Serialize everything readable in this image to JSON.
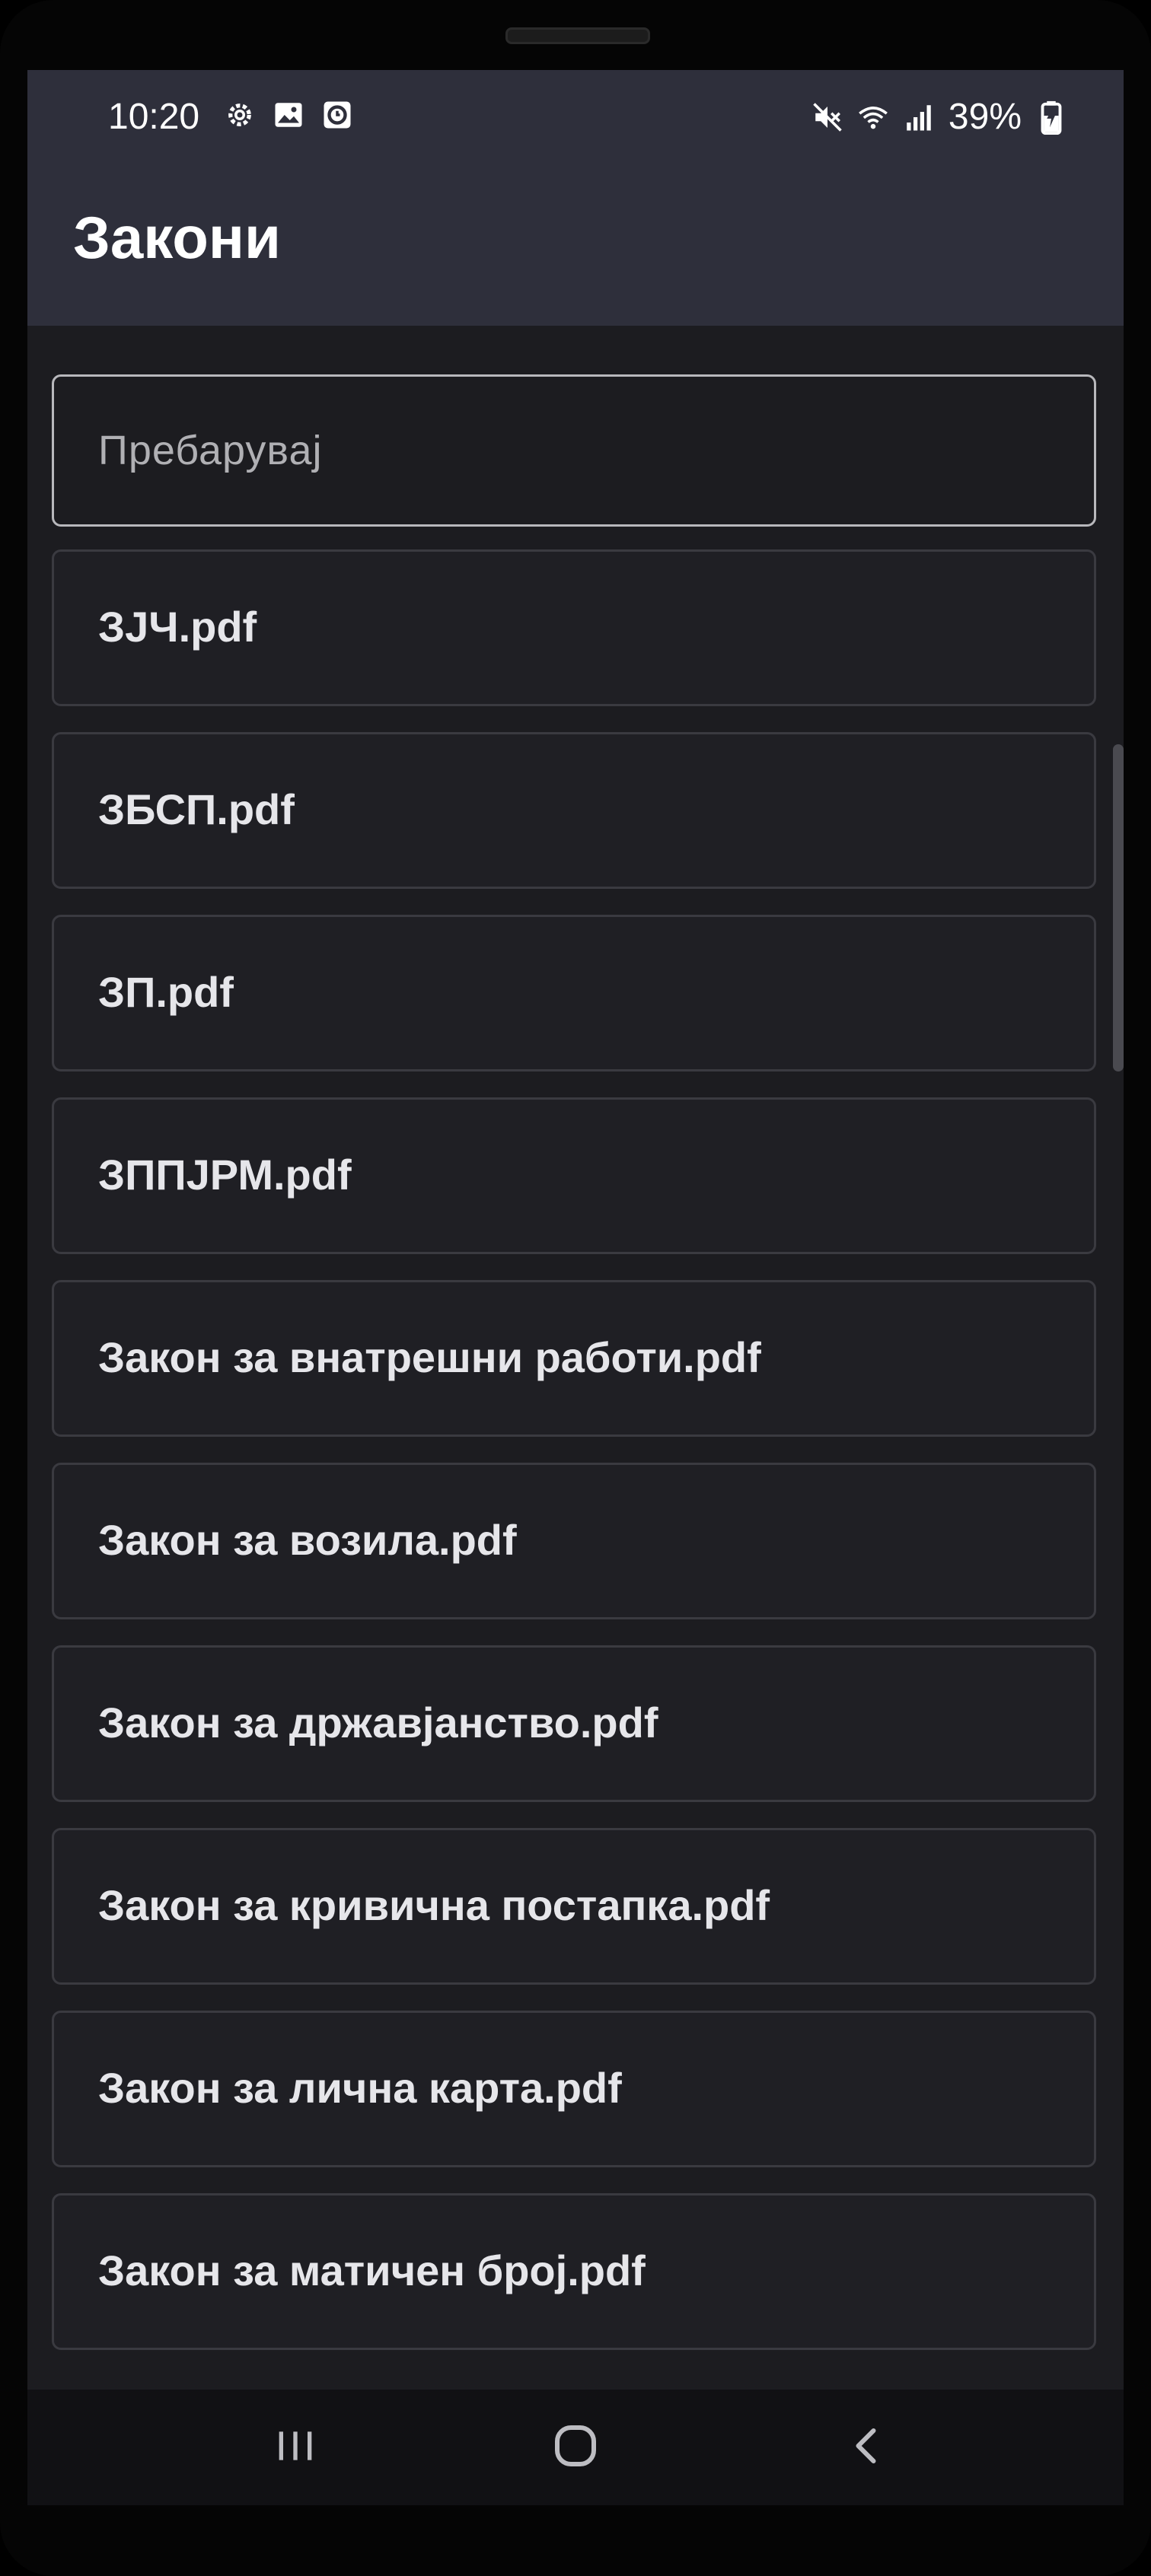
{
  "status": {
    "time": "10:20",
    "battery": "39%"
  },
  "appbar": {
    "title": "Закони"
  },
  "search": {
    "placeholder": "Пребарувај"
  },
  "files": [
    {
      "label": "ЗЈЧ.pdf"
    },
    {
      "label": "ЗБСП.pdf"
    },
    {
      "label": "ЗП.pdf"
    },
    {
      "label": "ЗППЈРМ.pdf"
    },
    {
      "label": "Закон за внатрешни работи.pdf"
    },
    {
      "label": "Закон за возила.pdf"
    },
    {
      "label": "Закон за државјанство.pdf"
    },
    {
      "label": "Закон за кривична постапка.pdf"
    },
    {
      "label": "Закон за лична карта.pdf"
    },
    {
      "label": "Закон за матичен број.pdf"
    }
  ],
  "icons": {
    "status_left": [
      "settings-icon",
      "image-icon",
      "clock-app-icon"
    ],
    "status_right": [
      "mute-icon",
      "wifi-icon",
      "signal-icon",
      "battery-charging-icon"
    ],
    "nav": [
      "recent-apps-icon",
      "home-icon",
      "back-icon"
    ]
  },
  "colors": {
    "appbar": "#2e2f3b",
    "background": "#1c1c20",
    "navbar": "#111114"
  }
}
